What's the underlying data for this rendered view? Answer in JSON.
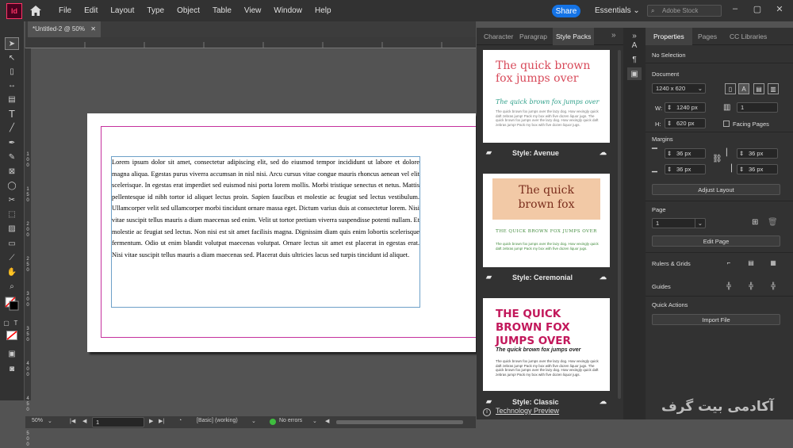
{
  "app": {
    "logo": "Id",
    "menu": [
      "File",
      "Edit",
      "Layout",
      "Type",
      "Object",
      "Table",
      "View",
      "Window",
      "Help"
    ],
    "share": "Share",
    "workspace": "Essentials",
    "stock_placeholder": "Adobe Stock",
    "accent": "#1473e6"
  },
  "document": {
    "tab": "*Untitled-2 @ 50%"
  },
  "ruler_v_labels": [
    "1",
    "0",
    "0",
    "1",
    "5",
    "0",
    "2",
    "0",
    "0",
    "2",
    "5",
    "0",
    "3",
    "0",
    "0",
    "3",
    "5",
    "0",
    "4",
    "0",
    "0",
    "4",
    "5",
    "0",
    "5",
    "0",
    "0"
  ],
  "page": {
    "body_text": "Lorem ipsum dolor sit amet, consectetur adipiscing elit, sed do eiusmod tempor incididunt ut labore et dolore magna aliqua. Egestas purus viverra accumsan in nisl nisi. Arcu cursus vitae congue mauris rhoncus aenean vel elit scelerisque. In egestas erat imperdiet sed euismod nisi porta lorem mollis. Morbi tristique senectus et netus. Mattis pellentesque id nibh tortor id aliquet lectus proin. Sapien faucibus et molestie ac feugiat sed lectus vestibulum. Ullamcorper velit sed ullamcorper morbi tincidunt ornare massa eget. Dictum varius duis at consectetur lorem. Nisi vitae suscipit tellus mauris a diam maecenas sed enim. Velit ut tortor pretium viverra suspendisse potenti nullam. Et molestie ac feugiat sed lectus. Non nisi est sit amet facilisis magna. Dignissim diam quis enim lobortis scelerisque fermentum. Odio ut enim blandit volutpat maecenas volutpat. Ornare lectus sit amet est placerat in egestas erat. Nisi vitae suscipit tellus mauris a diam maecenas sed. Placerat duis ultricies lacus sed turpis tincidunt id aliquet."
  },
  "status": {
    "zoom": "50%",
    "page": "1",
    "style": "[Basic] (working)",
    "errors": "No errors"
  },
  "style_packs": {
    "tabs": [
      "Character",
      "Paragrap",
      "Style Packs"
    ],
    "cards": [
      {
        "headline": "The quick brown fox jumps over",
        "sub": "The quick brown fox jumps over",
        "body": "The quick brown fox jumps over the lazy dog. How vexingly quick daft zebras jump! Pack my box with five dozen liquor jugs. The quick brown fox jumps over the lazy dog. How vexingly quick daft zebras jump! Pack my box with five dozen liquor jugs.",
        "label": "Style: Avenue",
        "head_color": "#d84a5a",
        "sub_color": "#2fa08a"
      },
      {
        "headline": "The quick brown fox",
        "sub": "THE QUICK BROWN FOX JUMPS OVER",
        "body": "The quick brown fox jumps over the lazy dog. How vexingly quick daft zebras jump! Pack my box with five dozen liquor jugs.",
        "label": "Style: Ceremonial",
        "head_color": "#7a2d1c",
        "sub_color": "#3f8a3a",
        "band": "#f2c9a6"
      },
      {
        "headline": "THE QUICK BROWN FOX JUMPS OVER",
        "sub": "The quick brown fox jumps over",
        "body": "The quick brown fox jumps over the lazy dog. How vexingly quick daft zebras jump! Pack my box with five dozen liquor jugs. The quick brown fox jumps over the lazy dog. How vexingly quick daft zebras jump! Pack my box with five dozen liquor jugs.",
        "label": "Style: Classic",
        "head_color": "#c2185b",
        "sub_color": "#222222"
      }
    ],
    "tech_preview": "Technology Preview"
  },
  "properties": {
    "tabs": [
      "Properties",
      "Pages",
      "CC Libraries"
    ],
    "selection": "No Selection",
    "document_label": "Document",
    "preset": "1240 x 620",
    "w_label": "W:",
    "w": "1240 px",
    "h_label": "H:",
    "h": "620 px",
    "pages_count": "1",
    "facing": "Facing Pages",
    "margins_label": "Margins",
    "margins": [
      "36 px",
      "36 px",
      "36 px",
      "36 px"
    ],
    "adjust": "Adjust Layout",
    "page_label": "Page",
    "page_value": "1",
    "edit_page": "Edit Page",
    "rulers": "Rulers & Grids",
    "guides": "Guides",
    "quick": "Quick Actions",
    "import": "Import File"
  },
  "watermark": "آکادمی بیت گرف"
}
